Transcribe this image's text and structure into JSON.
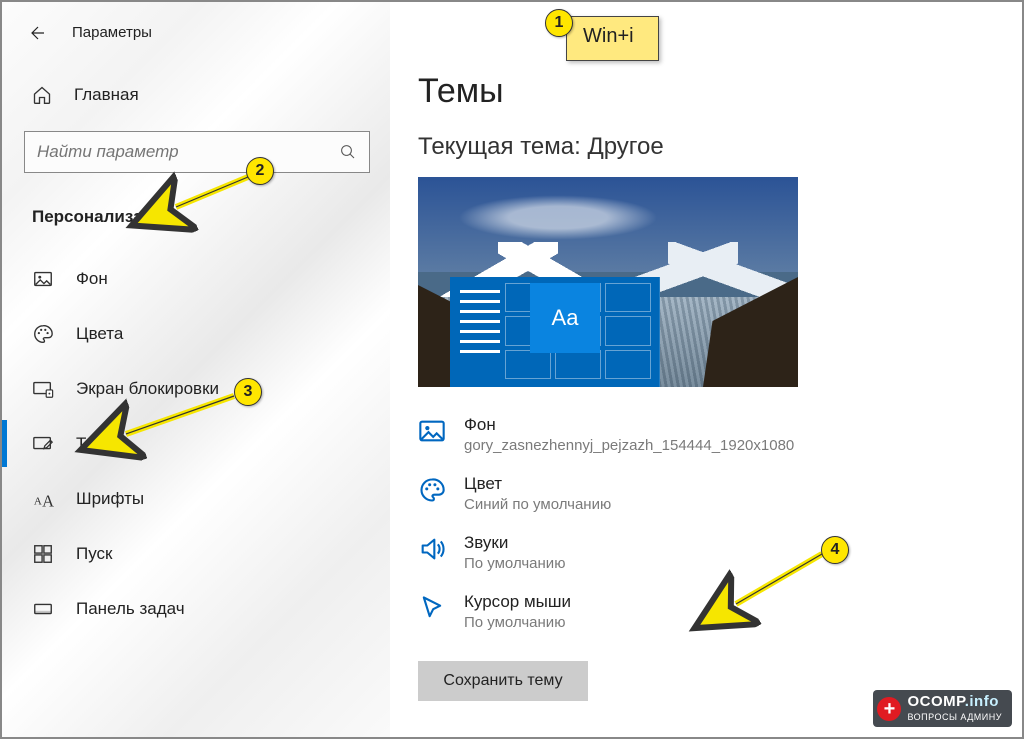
{
  "app_title": "Параметры",
  "home_label": "Главная",
  "search_placeholder": "Найти параметр",
  "section_title": "Персонализация",
  "nav": [
    {
      "label": "Фон"
    },
    {
      "label": "Цвета"
    },
    {
      "label": "Экран блокировки"
    },
    {
      "label": "Темы"
    },
    {
      "label": "Шрифты"
    },
    {
      "label": "Пуск"
    },
    {
      "label": "Панель задач"
    }
  ],
  "page_heading": "Темы",
  "current_theme_label": "Текущая тема: Другое",
  "preview_tile_text": "Aa",
  "props": {
    "bg": {
      "title": "Фон",
      "sub": "gory_zasnezhennyj_pejzazh_154444_1920x1080"
    },
    "color": {
      "title": "Цвет",
      "sub": "Синий по умолчанию"
    },
    "sound": {
      "title": "Звуки",
      "sub": "По умолчанию"
    },
    "cursor": {
      "title": "Курсор мыши",
      "sub": "По умолчанию"
    }
  },
  "save_button": "Сохранить тему",
  "annotations": {
    "callout1": "Win+i",
    "n1": "1",
    "n2": "2",
    "n3": "3",
    "n4": "4"
  },
  "watermark": {
    "site": "OCOMP",
    "tld": ".info",
    "tag": "ВОПРОСЫ АДМИНУ"
  }
}
